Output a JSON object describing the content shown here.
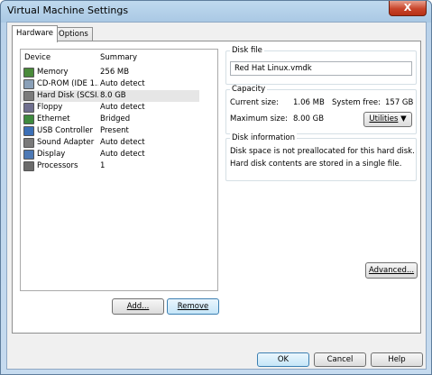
{
  "window": {
    "title": "Virtual Machine Settings",
    "close_glyph": "X"
  },
  "tabs": [
    {
      "label": "Hardware",
      "active": true
    },
    {
      "label": "Options",
      "active": false
    }
  ],
  "device_list": {
    "headers": {
      "device": "Device",
      "summary": "Summary"
    },
    "rows": [
      {
        "icon": "memory-icon",
        "name": "Memory",
        "summary": "256 MB",
        "selected": false,
        "color": "#4a8a3a"
      },
      {
        "icon": "cdrom-icon",
        "name": "CD-ROM (IDE 1...",
        "summary": "Auto detect",
        "selected": false,
        "color": "#8aa0b8"
      },
      {
        "icon": "hard-disk-icon",
        "name": "Hard Disk (SCSI...",
        "summary": "8.0 GB",
        "selected": true,
        "color": "#7b7b7b"
      },
      {
        "icon": "floppy-icon",
        "name": "Floppy",
        "summary": "Auto detect",
        "selected": false,
        "color": "#6f6f8f"
      },
      {
        "icon": "ethernet-icon",
        "name": "Ethernet",
        "summary": "Bridged",
        "selected": false,
        "color": "#3e8a3e"
      },
      {
        "icon": "usb-icon",
        "name": "USB Controller",
        "summary": "Present",
        "selected": false,
        "color": "#3b6fb6"
      },
      {
        "icon": "sound-icon",
        "name": "Sound Adapter",
        "summary": "Auto detect",
        "selected": false,
        "color": "#7a7a7a"
      },
      {
        "icon": "display-icon",
        "name": "Display",
        "summary": "Auto detect",
        "selected": false,
        "color": "#4d79b5"
      },
      {
        "icon": "processor-icon",
        "name": "Processors",
        "summary": "1",
        "selected": false,
        "color": "#6b6b6b"
      }
    ]
  },
  "buttons": {
    "add": "Add...",
    "remove": "Remove",
    "utilities": "Utilities",
    "advanced": "Advanced...",
    "ok": "OK",
    "cancel": "Cancel",
    "help": "Help"
  },
  "disk_file": {
    "title": "Disk file",
    "value": "Red Hat Linux.vmdk"
  },
  "capacity": {
    "title": "Capacity",
    "current_size_label": "Current size:",
    "current_size_value": "1.06 MB",
    "system_free_label": "System free:",
    "system_free_value": "157 GB",
    "maximum_size_label": "Maximum size:",
    "maximum_size_value": "8.00 GB"
  },
  "disk_information": {
    "title": "Disk information",
    "line1": "Disk space is not preallocated for this hard disk.",
    "line2": "Hard disk contents are stored in a single file."
  }
}
